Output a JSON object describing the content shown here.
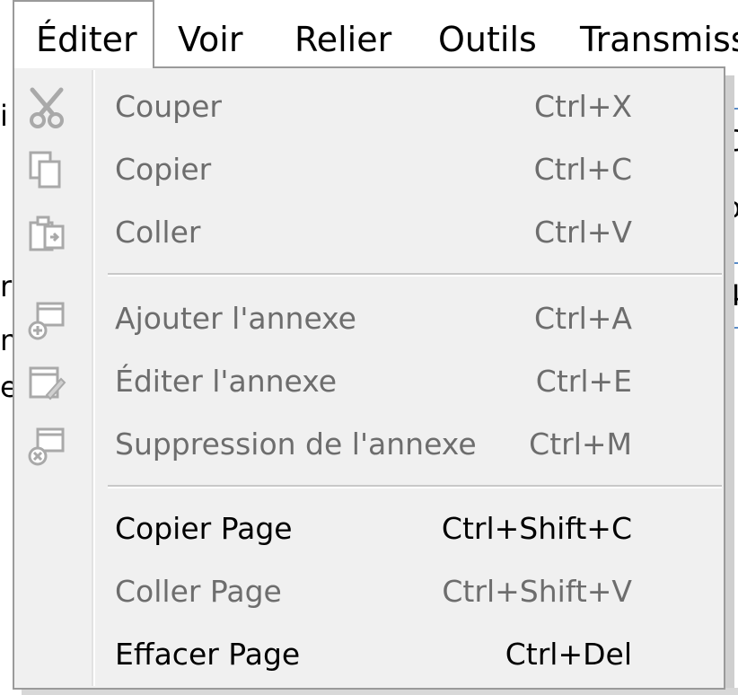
{
  "menubar": {
    "items": [
      {
        "label": "Éditer"
      },
      {
        "label": "Voir"
      },
      {
        "label": "Relier"
      },
      {
        "label": "Outils"
      },
      {
        "label": "Transmissi"
      }
    ]
  },
  "background": {
    "fragments": [
      "i",
      "C",
      "o",
      "4",
      "r",
      "n",
      "e"
    ]
  },
  "menu": {
    "groups": [
      {
        "items": [
          {
            "label": "Couper",
            "shortcut": "Ctrl+X",
            "icon": "scissors-icon",
            "enabled": false
          },
          {
            "label": "Copier",
            "shortcut": "Ctrl+C",
            "icon": "copy-icon",
            "enabled": false
          },
          {
            "label": "Coller",
            "shortcut": "Ctrl+V",
            "icon": "paste-icon",
            "enabled": false
          }
        ]
      },
      {
        "items": [
          {
            "label": "Ajouter l'annexe",
            "shortcut": "Ctrl+A",
            "icon": "add-annex-icon",
            "enabled": false
          },
          {
            "label": "Éditer l'annexe",
            "shortcut": "Ctrl+E",
            "icon": "edit-annex-icon",
            "enabled": false
          },
          {
            "label": "Suppression de l'annexe",
            "shortcut": "Ctrl+M",
            "icon": "delete-annex-icon",
            "enabled": false
          }
        ]
      },
      {
        "items": [
          {
            "label": "Copier Page",
            "shortcut": "Ctrl+Shift+C",
            "enabled": true
          },
          {
            "label": "Coller Page",
            "shortcut": "Ctrl+Shift+V",
            "enabled": false
          },
          {
            "label": "Effacer Page",
            "shortcut": "Ctrl+Del",
            "enabled": true
          }
        ]
      }
    ]
  },
  "colors": {
    "disabled_text": "#6d6d6d",
    "enabled_text": "#000000",
    "menu_background": "#f0f0f0",
    "menu_border": "#9a9a9a"
  }
}
